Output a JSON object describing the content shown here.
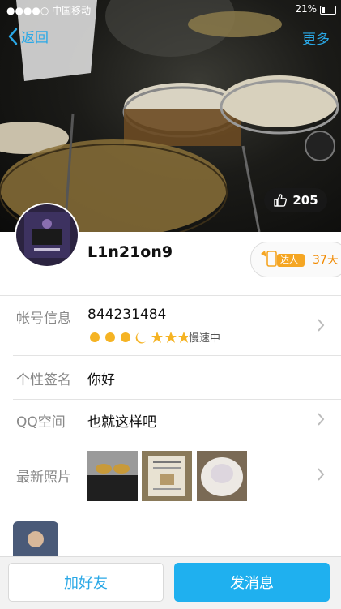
{
  "status_bar": {
    "carrier": "●●●●○ 中国移动",
    "battery": "21%"
  },
  "nav": {
    "back_label": "返回",
    "more_label": "更多"
  },
  "likes": {
    "count": "205"
  },
  "profile": {
    "nickname": "L1n21on9",
    "badge_label": "达人",
    "badge_days": "37天"
  },
  "account": {
    "label": "帐号信息",
    "qq_number": "844231484",
    "speed_text": "慢速中"
  },
  "signature": {
    "label": "个性签名",
    "value": "你好"
  },
  "qzone": {
    "label": "QQ空间",
    "value": "也就这样吧"
  },
  "photos": {
    "label": "最新照片"
  },
  "actions": {
    "add_friend": "加好友",
    "send_message": "发消息"
  },
  "colors": {
    "accent": "#1fb0ef",
    "link": "#2aa8e6",
    "badge_orange": "#f28a00"
  }
}
